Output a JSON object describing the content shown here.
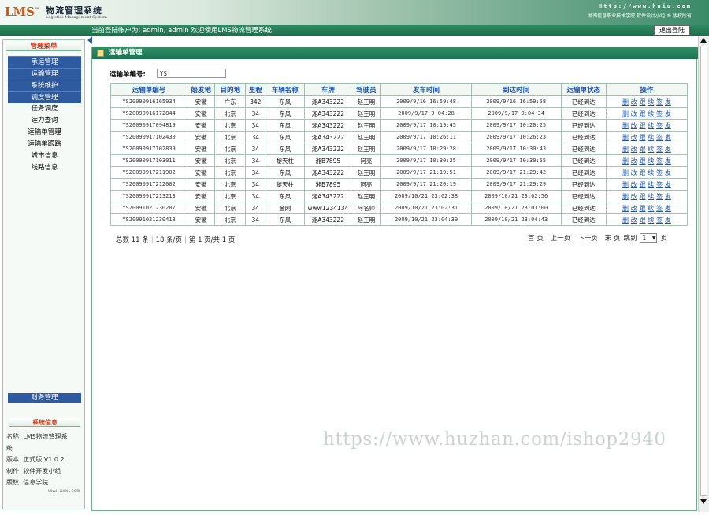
{
  "header": {
    "logo": "LMS",
    "logo_tm": "™",
    "brand": "物流管理系统",
    "brand_sub": "Logistics Management System",
    "site_url": "Http://www.hniu.com",
    "site_links": "湖南信息职业技术学院  软件设计小组 ® 版权所有"
  },
  "topbar": {
    "welcome": "当前登陆帐户为: admin, admin 欢迎使用LMS物流管理系统",
    "logout_label": "退出登陆"
  },
  "sidebar": {
    "title": "管理菜单",
    "items": [
      {
        "label": "承运管理",
        "active": true
      },
      {
        "label": "运输管理",
        "active": true
      },
      {
        "label": "系统维护",
        "active": true
      },
      {
        "label": "调度管理",
        "active": true
      },
      {
        "label": "任务调度",
        "active": false
      },
      {
        "label": "运力查询",
        "active": false
      },
      {
        "label": "运输单管理",
        "active": false
      },
      {
        "label": "运输单跟踪",
        "active": false
      },
      {
        "label": "城市信息",
        "active": false
      },
      {
        "label": "线路信息",
        "active": false
      }
    ],
    "finance": "财务管理",
    "sys_title": "系统信息",
    "sys_lines": [
      "名称: LMS物流管理系",
      "统",
      "版本: 正式版 V1.0.2",
      "制作: 软件开发小组",
      "版权: 信息学院"
    ],
    "sys_url": "www.xxx.com"
  },
  "main": {
    "title": "运输单管理",
    "search_label": "运输单编号:",
    "search_value": "YS",
    "columns": [
      "运输单编号",
      "始发地",
      "目的地",
      "里程",
      "车辆名称",
      "车牌",
      "驾驶员",
      "发车时间",
      "到达时间",
      "运输单状态",
      "操作"
    ],
    "rows": [
      [
        "YS20090916165934",
        "安徽",
        "广东",
        "342",
        "东风",
        "湘A343222",
        "赵王明",
        "2009/9/16 16:59:48",
        "2009/9/16 16:59:58",
        "已经到达"
      ],
      [
        "YS20090916172844",
        "安徽",
        "北京",
        "34",
        "东风",
        "湘A343222",
        "赵王明",
        "2009/9/17 9:04:28",
        "2009/9/17 9:04:34",
        "已经到达"
      ],
      [
        "YS20090917094819",
        "安徽",
        "北京",
        "34",
        "东风",
        "湘A343222",
        "赵王明",
        "2009/9/17 10:19:45",
        "2009/9/17 10:20:25",
        "已经到达"
      ],
      [
        "YS20090917102430",
        "安徽",
        "北京",
        "34",
        "东风",
        "湘A343222",
        "赵王明",
        "2009/9/17 10:26:11",
        "2009/9/17 10:26:23",
        "已经到达"
      ],
      [
        "YS20090917102839",
        "安徽",
        "北京",
        "34",
        "东风",
        "湘A343222",
        "赵王明",
        "2009/9/17 10:29:28",
        "2009/9/17 10:30:43",
        "已经到达"
      ],
      [
        "YS20090917103011",
        "安徽",
        "北京",
        "34",
        "黎天柱",
        "湘B7895",
        "阿亮",
        "2009/9/17 10:30:25",
        "2009/9/17 10:30:55",
        "已经到达"
      ],
      [
        "YS20090917211902",
        "安徽",
        "北京",
        "34",
        "东风",
        "湘A343222",
        "赵王明",
        "2009/9/17 21:19:51",
        "2009/9/17 21:29:42",
        "已经到达"
      ],
      [
        "YS20090917212002",
        "安徽",
        "北京",
        "34",
        "黎天柱",
        "湘B7895",
        "阿亮",
        "2009/9/17 21:20:19",
        "2009/9/17 21:29:29",
        "已经到达"
      ],
      [
        "YS20090917213213",
        "安徽",
        "北京",
        "34",
        "东风",
        "湘A343222",
        "赵王明",
        "2009/10/21 23:02:38",
        "2009/10/21 23:02:56",
        "已经到达"
      ],
      [
        "YS20091021230207",
        "安徽",
        "北京",
        "34",
        "金刚",
        "www1234134",
        "阿名师",
        "2009/10/21 23:02:31",
        "2009/10/21 23:03:00",
        "已经到达"
      ],
      [
        "YS20091021230418",
        "安徽",
        "北京",
        "34",
        "东风",
        "湘A343222",
        "赵王明",
        "2009/10/21 23:04:39",
        "2009/10/21 23:04:43",
        "已经到达"
      ]
    ],
    "ops": [
      "删",
      "改",
      "跟",
      "续",
      "签",
      "发"
    ],
    "pager": {
      "total": "总数 11 条",
      "per_page": "18 条/页",
      "page_info": "第 1 页/共 1 页",
      "first": "首 页",
      "prev": "上一页",
      "next": "下一页",
      "last": "末 页",
      "jump": "跳到",
      "jump_value": "1",
      "page_unit": "页"
    }
  },
  "watermark": "https://www.huzhan.com/ishop2940"
}
